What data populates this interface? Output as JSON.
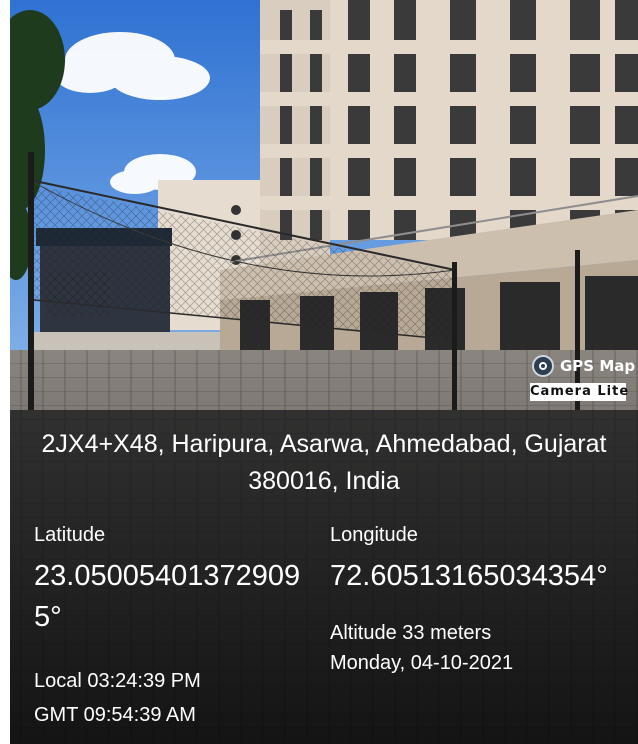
{
  "watermark": {
    "brand": "GPS Map",
    "product": "Camera Lite"
  },
  "address": {
    "line1": "2JX4+X48, Haripura, Asarwa, Ahmedabad, Gujarat",
    "line2": "380016, India"
  },
  "location": {
    "latitude_label": "Latitude",
    "latitude_line1": "23.05005401372909",
    "latitude_line2": "5°",
    "longitude_label": "Longitude",
    "longitude_value": "72.60513165034354°",
    "altitude": "Altitude 33 meters",
    "date": "Monday, 04-10-2021",
    "local_time": "Local 03:24:39 PM",
    "gmt_time": "GMT 09:54:39 AM"
  }
}
